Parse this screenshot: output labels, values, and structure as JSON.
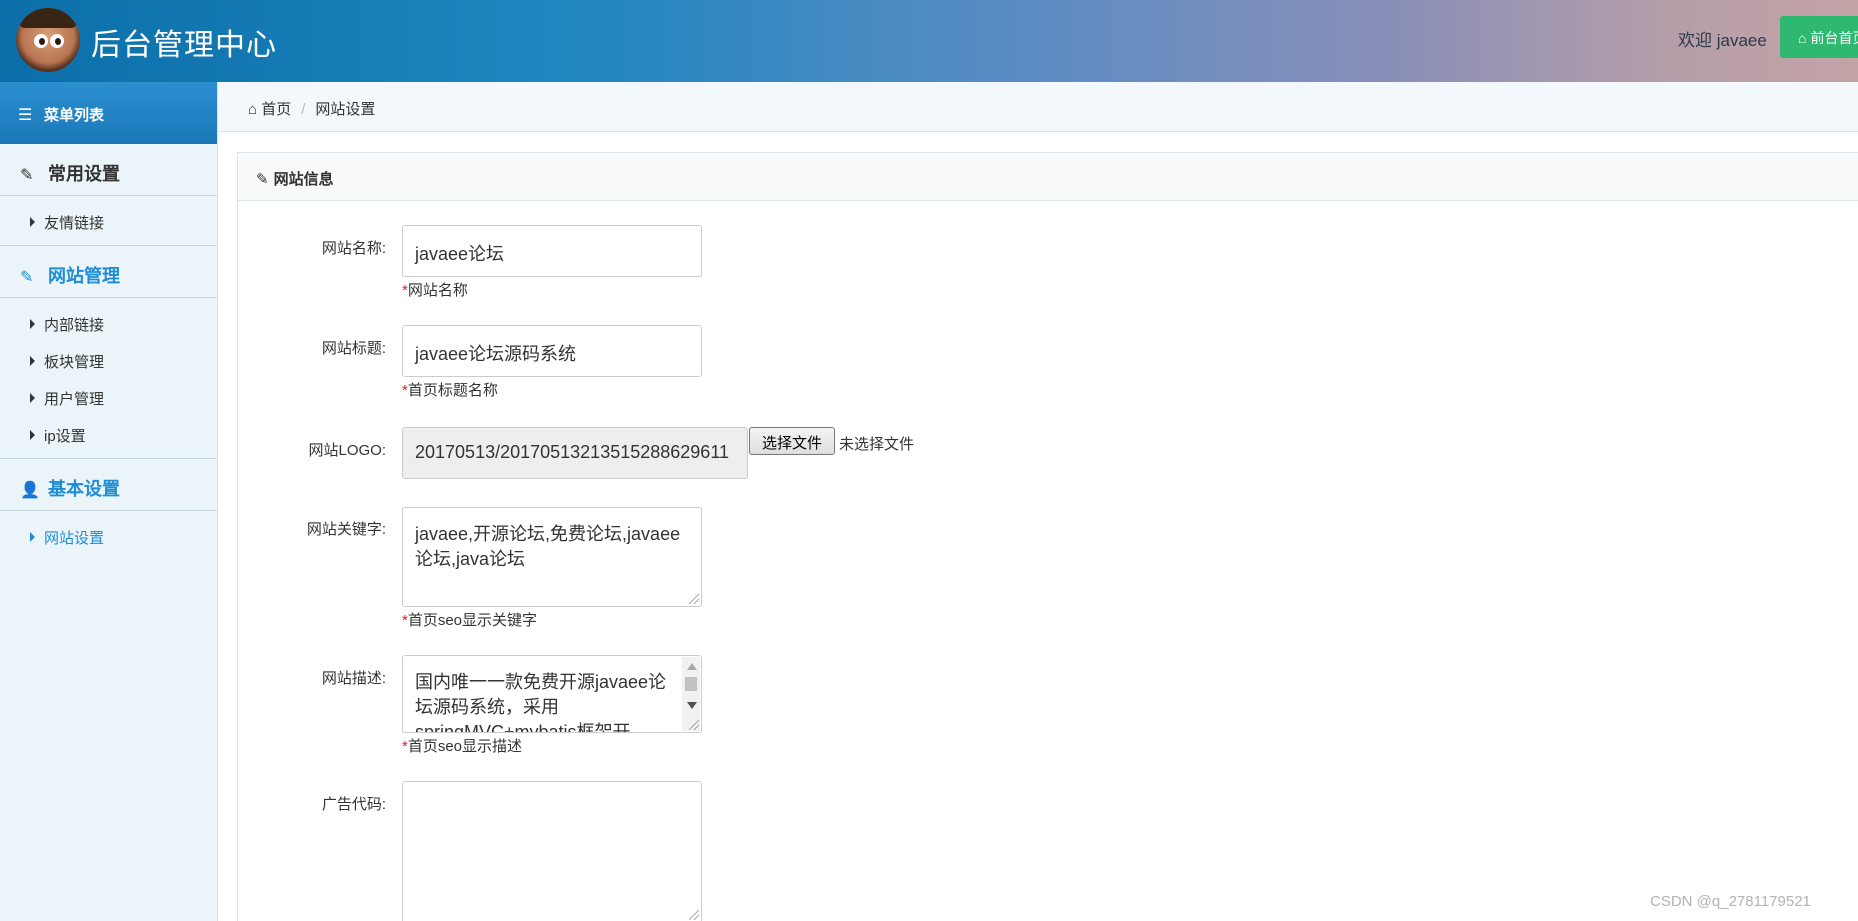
{
  "header": {
    "title": "后台管理中心",
    "welcome": "欢迎 javaee",
    "front_button": "前台首页",
    "brand_color": "#1e86c0",
    "button_color": "#2fb870"
  },
  "sidebar": {
    "menu_title": "菜单列表",
    "groups": [
      {
        "label": "常用设置",
        "icon": "edit-icon",
        "items": [
          "友情链接"
        ]
      },
      {
        "label": "网站管理",
        "icon": "edit-icon",
        "items": [
          "内部链接",
          "板块管理",
          "用户管理",
          "ip设置"
        ]
      },
      {
        "label": "基本设置",
        "icon": "user-icon",
        "items": [
          "网站设置"
        ]
      }
    ]
  },
  "breadcrumb": {
    "home": "首页",
    "current": "网站设置"
  },
  "panel": {
    "title": "网站信息",
    "fields": {
      "site_name": {
        "label": "网站名称:",
        "value": "javaee论坛",
        "hint": "网站名称"
      },
      "site_title": {
        "label": "网站标题:",
        "value": "javaee论坛源码系统",
        "hint": "首页标题名称"
      },
      "site_logo": {
        "label": "网站LOGO:",
        "value": "20170513/20170513213515288629611",
        "file_button": "选择文件",
        "file_status": "未选择文件"
      },
      "keywords": {
        "label": "网站关键字:",
        "value": "javaee,开源论坛,免费论坛,javaee论坛,java论坛",
        "hint": "首页seo显示关键字"
      },
      "description": {
        "label": "网站描述:",
        "value": "国内唯一一款免费开源javaee论坛源码系统，采用springMVC+mybatis框架开",
        "hint": "首页seo显示描述"
      },
      "ad_code": {
        "label": "广告代码:",
        "value": ""
      }
    },
    "required_mark": "*"
  },
  "watermark": "CSDN @q_2781179521"
}
